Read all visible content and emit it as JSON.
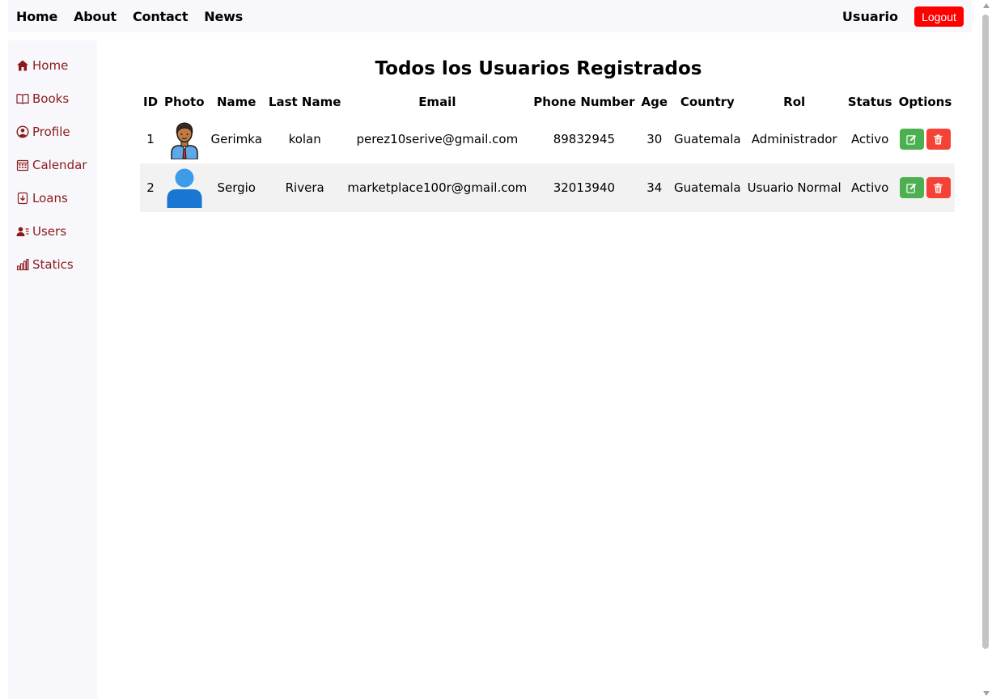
{
  "nav": {
    "links": [
      "Home",
      "About",
      "Contact",
      "News"
    ],
    "user_label": "Usuario",
    "logout_label": "Logout"
  },
  "sidebar": {
    "items": [
      {
        "label": "Home",
        "icon": "home-icon"
      },
      {
        "label": "Books",
        "icon": "book-icon"
      },
      {
        "label": "Profile",
        "icon": "user-circle-icon"
      },
      {
        "label": "Calendar",
        "icon": "calendar-icon"
      },
      {
        "label": "Loans",
        "icon": "loans-icon"
      },
      {
        "label": "Users",
        "icon": "users-list-icon"
      },
      {
        "label": "Statics",
        "icon": "bar-chart-icon"
      }
    ],
    "color": "#8b1a1a"
  },
  "main": {
    "title": "Todos los Usuarios Registrados",
    "columns": [
      "ID",
      "Photo",
      "Name",
      "Last Name",
      "Email",
      "Phone Number",
      "Age",
      "Country",
      "Rol",
      "Status",
      "Options"
    ],
    "rows": [
      {
        "id": "1",
        "photo": "businessman-avatar",
        "name": "Gerimka",
        "last_name": "kolan",
        "email": "perez10serive@gmail.com",
        "phone": "89832945",
        "age": "30",
        "country": "Guatemala",
        "rol": "Administrador",
        "status": "Activo"
      },
      {
        "id": "2",
        "photo": "default-user-avatar",
        "name": "Sergio",
        "last_name": "Rivera",
        "email": "marketplace100r@gmail.com",
        "phone": "32013940",
        "age": "34",
        "country": "Guatemala",
        "rol": "Usuario Normal",
        "status": "Activo"
      }
    ],
    "row_actions": [
      "edit-icon",
      "trash-icon"
    ]
  },
  "colors": {
    "logout": "#ff0000",
    "edit": "#4caf50",
    "delete": "#f44336",
    "panel": "#f8f8fc"
  }
}
